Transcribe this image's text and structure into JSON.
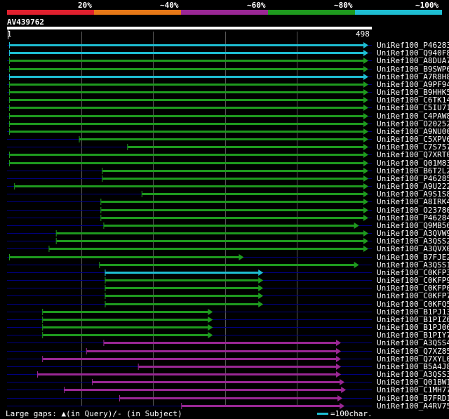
{
  "legend": {
    "labels": [
      "20%",
      "~40%",
      "~60%",
      "~80%",
      "~100%"
    ],
    "colors": [
      "#e0202e",
      "#e67817",
      "#9a2795",
      "#1e9a1e",
      "#1ebdd2"
    ]
  },
  "query": {
    "id": "AV439762",
    "start": "1",
    "end": "498"
  },
  "colors": {
    "cyan": "#1ebdd2",
    "green": "#1e9a1e",
    "purple": "#9a2795",
    "gap_line": "#000080",
    "grid": "#ffffff",
    "marker": "#ffff80"
  },
  "hits": [
    {
      "label": "UniRef100_P46283",
      "color": "cyan",
      "start": 1,
      "end": 498
    },
    {
      "label": "UniRef100_Q940F8",
      "color": "cyan",
      "start": 1,
      "end": 498
    },
    {
      "label": "UniRef100_A8DUA7",
      "color": "green",
      "start": 1,
      "end": 498
    },
    {
      "label": "UniRef100_B9SWP6",
      "color": "green",
      "start": 1,
      "end": 498
    },
    {
      "label": "UniRef100_A7R8H8",
      "color": "cyan",
      "start": 1,
      "end": 498
    },
    {
      "label": "UniRef100_A9PF94",
      "color": "green",
      "start": 1,
      "end": 498
    },
    {
      "label": "UniRef100_B9HHK5",
      "color": "green",
      "start": 1,
      "end": 498
    },
    {
      "label": "UniRef100_C6TK14",
      "color": "green",
      "start": 1,
      "end": 498
    },
    {
      "label": "UniRef100_C5IU71",
      "color": "green",
      "start": 1,
      "end": 498
    },
    {
      "label": "UniRef100_C4PAW8",
      "color": "green",
      "start": 1,
      "end": 498
    },
    {
      "label": "UniRef100_O20252",
      "color": "green",
      "start": 1,
      "end": 498
    },
    {
      "label": "UniRef100_A9NU00",
      "color": "green",
      "start": 1,
      "end": 498
    },
    {
      "label": "UniRef100_C5XPV6",
      "color": "green",
      "start": 98,
      "end": 498
    },
    {
      "label": "UniRef100_C7S757",
      "color": "green",
      "start": 165,
      "end": 498
    },
    {
      "label": "UniRef100_Q7XRT0",
      "color": "green",
      "start": 1,
      "end": 498
    },
    {
      "label": "UniRef100_Q01M83",
      "color": "green",
      "start": 1,
      "end": 498
    },
    {
      "label": "UniRef100_B6T2L2",
      "color": "green",
      "start": 130,
      "end": 498
    },
    {
      "label": "UniRef100_P46285",
      "color": "green",
      "start": 130,
      "end": 498
    },
    {
      "label": "UniRef100_A9U222",
      "color": "green",
      "start": 8,
      "end": 498
    },
    {
      "label": "UniRef100_A9S1S8",
      "color": "green",
      "start": 185,
      "end": 498
    },
    {
      "label": "UniRef100_A8IRK4",
      "color": "green",
      "start": 128,
      "end": 498
    },
    {
      "label": "UniRef100_O23780",
      "color": "green",
      "start": 128,
      "end": 498
    },
    {
      "label": "UniRef100_P46284",
      "color": "green",
      "start": 128,
      "end": 498
    },
    {
      "label": "UniRef100_Q9MB56",
      "color": "green",
      "start": 132,
      "end": 485
    },
    {
      "label": "UniRef100_A3QVW9",
      "color": "green",
      "start": 66,
      "end": 498
    },
    {
      "label": "UniRef100_A3QSS2",
      "color": "green",
      "start": 66,
      "end": 498
    },
    {
      "label": "UniRef100_A3QVX0",
      "color": "green",
      "start": 56,
      "end": 498
    },
    {
      "label": "UniRef100_B7FJE2",
      "color": "green",
      "start": 1,
      "end": 325
    },
    {
      "label": "UniRef100_A3QSS1",
      "color": "green",
      "start": 126,
      "end": 485
    },
    {
      "label": "UniRef100_C0KFP3",
      "color": "cyan",
      "start": 134,
      "end": 352
    },
    {
      "label": "UniRef100_C0KFP9",
      "color": "green",
      "start": 134,
      "end": 352
    },
    {
      "label": "UniRef100_C0KFP0",
      "color": "green",
      "start": 134,
      "end": 352
    },
    {
      "label": "UniRef100_C0KFP7",
      "color": "green",
      "start": 134,
      "end": 352
    },
    {
      "label": "UniRef100_C0KFQ5",
      "color": "green",
      "start": 134,
      "end": 352
    },
    {
      "label": "UniRef100_B1PJ13",
      "color": "green",
      "start": 47,
      "end": 282
    },
    {
      "label": "UniRef100_B1PIZ6",
      "color": "green",
      "start": 47,
      "end": 282
    },
    {
      "label": "UniRef100_B1PJ06",
      "color": "green",
      "start": 47,
      "end": 282
    },
    {
      "label": "UniRef100_B1PIY7",
      "color": "green",
      "start": 47,
      "end": 282
    },
    {
      "label": "UniRef100_A3QSS4",
      "color": "purple",
      "start": 132,
      "end": 460
    },
    {
      "label": "UniRef100_Q7XZ85",
      "color": "purple",
      "start": 108,
      "end": 460
    },
    {
      "label": "UniRef100_Q7XYL0",
      "color": "purple",
      "start": 47,
      "end": 460
    },
    {
      "label": "UniRef100_B5A4J8",
      "color": "purple",
      "start": 180,
      "end": 460
    },
    {
      "label": "UniRef100_A3QSS3",
      "color": "purple",
      "start": 40,
      "end": 460
    },
    {
      "label": "UniRef100_Q01BW1",
      "color": "purple",
      "start": 116,
      "end": 465
    },
    {
      "label": "UniRef100_C1MH77",
      "color": "purple",
      "start": 77,
      "end": 467
    },
    {
      "label": "UniRef100_B7FRD1",
      "color": "purple",
      "start": 154,
      "end": 462
    },
    {
      "label": "UniRef100_A4RV75",
      "color": "purple",
      "start": 240,
      "end": 465
    }
  ],
  "footer": {
    "gaps_text": "Large gaps: ▲(in Query)/- (in Subject)",
    "scale_text": "=100char."
  }
}
